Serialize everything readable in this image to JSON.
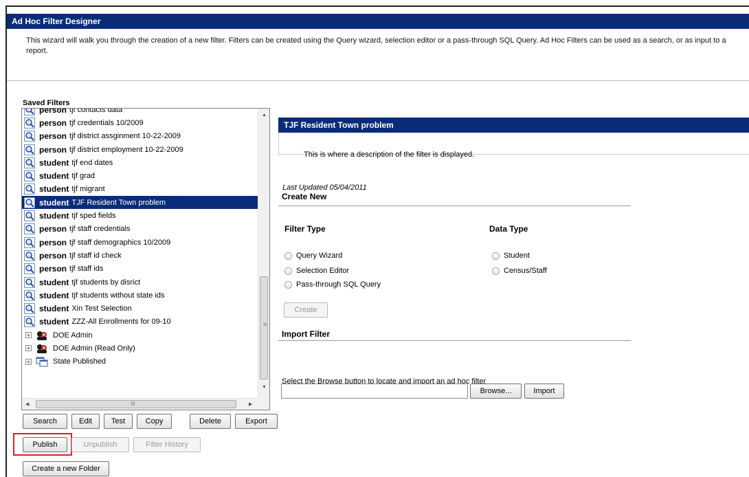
{
  "header": {
    "title": "Ad Hoc Filter Designer",
    "intro": "This wizard will walk you through the creation of a new filter. Filters can be created using the Query wizard, selection editor or a pass-through SQL Query. Ad Hoc Filters can be used as a search, or as input to a report."
  },
  "saved_filters": {
    "label": "Saved Filters",
    "items": [
      {
        "type": "person",
        "name": "tjf contacts data"
      },
      {
        "type": "person",
        "name": "tjf credentials 10/2009"
      },
      {
        "type": "person",
        "name": "tjf district assginment 10-22-2009"
      },
      {
        "type": "person",
        "name": "tjf district employment 10-22-2009"
      },
      {
        "type": "student",
        "name": "tjf end dates"
      },
      {
        "type": "student",
        "name": "tjf grad"
      },
      {
        "type": "student",
        "name": "tjf migrant"
      },
      {
        "type": "student",
        "name": "TJF Resident Town problem"
      },
      {
        "type": "student",
        "name": "tjf sped fields"
      },
      {
        "type": "person",
        "name": "tjf staff credentials"
      },
      {
        "type": "person",
        "name": "tjf staff demographics 10/2009"
      },
      {
        "type": "person",
        "name": "tjf staff id check"
      },
      {
        "type": "person",
        "name": "tjf staff ids"
      },
      {
        "type": "student",
        "name": "tjf students by disrict"
      },
      {
        "type": "student",
        "name": "tjf students without state ids"
      },
      {
        "type": "student",
        "name": "Xin Test Selection"
      },
      {
        "type": "student",
        "name": "ZZZ-All Enrollments for 09-10"
      }
    ],
    "folders": [
      {
        "name": "DOE Admin"
      },
      {
        "name": "DOE Admin (Read Only)"
      },
      {
        "name": "State Published"
      }
    ],
    "hscroll_grip": "III",
    "vscroll_grip": "≡"
  },
  "buttons": {
    "search": "Search",
    "edit": "Edit",
    "test": "Test",
    "copy": "Copy",
    "delete": "Delete",
    "export": "Export",
    "publish": "Publish",
    "unpublish": "Unpublish",
    "filter_history": "Filter History",
    "create_folder": "Create a new Folder"
  },
  "detail": {
    "title": "TJF Resident Town problem",
    "description": "This is where a description of the filter is displayed.",
    "last_updated": "Last Updated 05/04/2011"
  },
  "create_new": {
    "heading": "Create New",
    "filter_type_label": "Filter Type",
    "data_type_label": "Data Type",
    "filter_types": [
      "Query Wizard",
      "Selection Editor",
      "Pass-through SQL Query"
    ],
    "data_types": [
      "Student",
      "Census/Staff"
    ],
    "create_button": "Create"
  },
  "import_filter": {
    "heading": "Import Filter",
    "instructions": "Select the Browse button to locate and import an ad hoc filter",
    "file_value": "",
    "browse_button": "Browse...",
    "import_button": "Import"
  },
  "colors": {
    "header_bg": "#0a2c78",
    "selection_bg": "#0a2c78",
    "highlight": "#e02020"
  },
  "selected_filter_index": 7
}
